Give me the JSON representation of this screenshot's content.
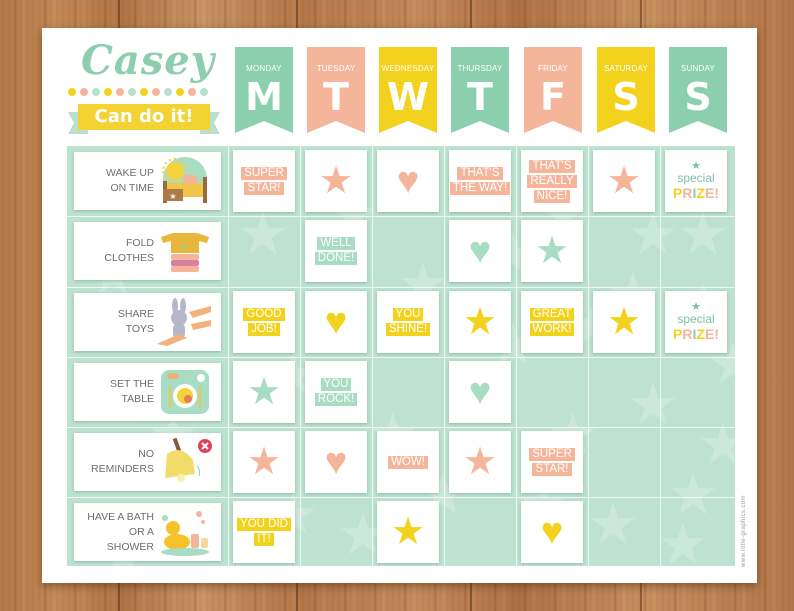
{
  "chart_title": {
    "name": "Casey",
    "banner": "Can do it!"
  },
  "colors": {
    "mint": "#8ccfae",
    "peach": "#f4b59b",
    "yellow": "#f3d21e",
    "grid_bg": "#bde2d1",
    "text_gray": "#6e6e6e"
  },
  "dots": [
    "#f3d21e",
    "#f4b59b",
    "#b9dfcd",
    "#f3d21e",
    "#f4b59b",
    "#b9dfcd",
    "#f3d21e",
    "#f4b59b",
    "#b9dfcd",
    "#f3d21e",
    "#f4b59b",
    "#b9dfcd"
  ],
  "days": [
    {
      "name": "MONDAY",
      "letter": "M",
      "color": "#8ccfae"
    },
    {
      "name": "TUESDAY",
      "letter": "T",
      "color": "#f4b59b"
    },
    {
      "name": "WEDNESDAY",
      "letter": "W",
      "color": "#f3d21e"
    },
    {
      "name": "THURSDAY",
      "letter": "T",
      "color": "#8ccfae"
    },
    {
      "name": "FRIDAY",
      "letter": "F",
      "color": "#f4b59b"
    },
    {
      "name": "SATURDAY",
      "letter": "S",
      "color": "#f3d21e"
    },
    {
      "name": "SUNDAY",
      "letter": "S",
      "color": "#8ccfae"
    }
  ],
  "tasks": [
    {
      "line1": "WAKE UP",
      "line2": "ON TIME",
      "icon": "bed-sun-icon"
    },
    {
      "line1": "FOLD",
      "line2": "CLOTHES",
      "icon": "folded-clothes-icon"
    },
    {
      "line1": "SHARE",
      "line2": "TOYS",
      "icon": "bunny-toy-icon"
    },
    {
      "line1": "SET THE",
      "line2": "TABLE",
      "icon": "plate-setting-icon"
    },
    {
      "line1": "NO",
      "line2": "REMINDERS",
      "icon": "bell-icon"
    },
    {
      "line1": "HAVE A BATH",
      "line2": "OR A SHOWER",
      "icon": "rubber-duck-icon"
    }
  ],
  "cells": [
    [
      {
        "type": "text",
        "lines": [
          "SUPER",
          "STAR!"
        ],
        "color": "#f4b59b"
      },
      {
        "type": "star",
        "color": "#f4b59b"
      },
      {
        "type": "heart",
        "color": "#f4b59b"
      },
      {
        "type": "text",
        "lines": [
          "THAT'S",
          "THE WAY!"
        ],
        "color": "#f4b59b"
      },
      {
        "type": "text",
        "lines": [
          "THAT'S",
          "REALLY",
          "NICE!"
        ],
        "color": "#f4b59b"
      },
      {
        "type": "star",
        "color": "#f4b59b"
      },
      {
        "type": "prize",
        "special": "special",
        "prize": "PRIZE!"
      }
    ],
    [
      null,
      {
        "type": "text",
        "lines": [
          "WELL",
          "DONE!"
        ],
        "color": "#a8dcc4"
      },
      null,
      {
        "type": "heart",
        "color": "#a8dcc4"
      },
      {
        "type": "star",
        "color": "#a8dcc4"
      },
      null,
      null
    ],
    [
      {
        "type": "text",
        "lines": [
          "GOOD",
          "JOB!"
        ],
        "color": "#f3d21e"
      },
      {
        "type": "heart",
        "color": "#f3d21e"
      },
      {
        "type": "text",
        "lines": [
          "YOU",
          "SHINE!"
        ],
        "color": "#f3d21e"
      },
      {
        "type": "star",
        "color": "#f3d21e"
      },
      {
        "type": "text",
        "lines": [
          "GREAT",
          "WORK!"
        ],
        "color": "#f3d21e"
      },
      {
        "type": "star",
        "color": "#f3d21e"
      },
      {
        "type": "prize",
        "special": "special",
        "prize": "PRIZE!"
      }
    ],
    [
      {
        "type": "star",
        "color": "#a8dcc4"
      },
      {
        "type": "text",
        "lines": [
          "YOU",
          "ROCK!"
        ],
        "color": "#a8dcc4"
      },
      null,
      {
        "type": "heart",
        "color": "#a8dcc4"
      },
      null,
      null,
      null
    ],
    [
      {
        "type": "star",
        "color": "#f4b59b"
      },
      {
        "type": "heart",
        "color": "#f4b59b"
      },
      {
        "type": "text",
        "lines": [
          "WOW!"
        ],
        "color": "#f4b59b"
      },
      {
        "type": "star",
        "color": "#f4b59b"
      },
      {
        "type": "text",
        "lines": [
          "SUPER",
          "STAR!"
        ],
        "color": "#f4b59b"
      },
      null,
      null
    ],
    [
      {
        "type": "text",
        "lines": [
          "YOU DID",
          "IT!"
        ],
        "color": "#f3d21e"
      },
      null,
      {
        "type": "star",
        "color": "#f3d21e"
      },
      null,
      {
        "type": "heart",
        "color": "#f3d21e"
      },
      null,
      null
    ]
  ],
  "prize_letter_colors": [
    "#f3d21e",
    "#f4b59b",
    "#8ccfae",
    "#f3d21e",
    "#f4b59b",
    "#f4b59b"
  ],
  "credit": "www.little-graphics.com"
}
